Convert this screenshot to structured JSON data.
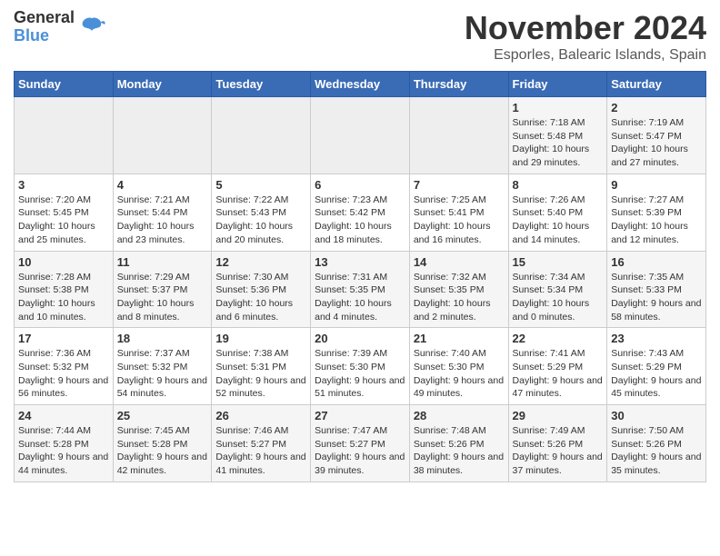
{
  "logo": {
    "line1": "General",
    "line2": "Blue"
  },
  "title": "November 2024",
  "location": "Esporles, Balearic Islands, Spain",
  "headers": [
    "Sunday",
    "Monday",
    "Tuesday",
    "Wednesday",
    "Thursday",
    "Friday",
    "Saturday"
  ],
  "weeks": [
    [
      {
        "day": "",
        "info": ""
      },
      {
        "day": "",
        "info": ""
      },
      {
        "day": "",
        "info": ""
      },
      {
        "day": "",
        "info": ""
      },
      {
        "day": "",
        "info": ""
      },
      {
        "day": "1",
        "info": "Sunrise: 7:18 AM\nSunset: 5:48 PM\nDaylight: 10 hours and 29 minutes."
      },
      {
        "day": "2",
        "info": "Sunrise: 7:19 AM\nSunset: 5:47 PM\nDaylight: 10 hours and 27 minutes."
      }
    ],
    [
      {
        "day": "3",
        "info": "Sunrise: 7:20 AM\nSunset: 5:45 PM\nDaylight: 10 hours and 25 minutes."
      },
      {
        "day": "4",
        "info": "Sunrise: 7:21 AM\nSunset: 5:44 PM\nDaylight: 10 hours and 23 minutes."
      },
      {
        "day": "5",
        "info": "Sunrise: 7:22 AM\nSunset: 5:43 PM\nDaylight: 10 hours and 20 minutes."
      },
      {
        "day": "6",
        "info": "Sunrise: 7:23 AM\nSunset: 5:42 PM\nDaylight: 10 hours and 18 minutes."
      },
      {
        "day": "7",
        "info": "Sunrise: 7:25 AM\nSunset: 5:41 PM\nDaylight: 10 hours and 16 minutes."
      },
      {
        "day": "8",
        "info": "Sunrise: 7:26 AM\nSunset: 5:40 PM\nDaylight: 10 hours and 14 minutes."
      },
      {
        "day": "9",
        "info": "Sunrise: 7:27 AM\nSunset: 5:39 PM\nDaylight: 10 hours and 12 minutes."
      }
    ],
    [
      {
        "day": "10",
        "info": "Sunrise: 7:28 AM\nSunset: 5:38 PM\nDaylight: 10 hours and 10 minutes."
      },
      {
        "day": "11",
        "info": "Sunrise: 7:29 AM\nSunset: 5:37 PM\nDaylight: 10 hours and 8 minutes."
      },
      {
        "day": "12",
        "info": "Sunrise: 7:30 AM\nSunset: 5:36 PM\nDaylight: 10 hours and 6 minutes."
      },
      {
        "day": "13",
        "info": "Sunrise: 7:31 AM\nSunset: 5:35 PM\nDaylight: 10 hours and 4 minutes."
      },
      {
        "day": "14",
        "info": "Sunrise: 7:32 AM\nSunset: 5:35 PM\nDaylight: 10 hours and 2 minutes."
      },
      {
        "day": "15",
        "info": "Sunrise: 7:34 AM\nSunset: 5:34 PM\nDaylight: 10 hours and 0 minutes."
      },
      {
        "day": "16",
        "info": "Sunrise: 7:35 AM\nSunset: 5:33 PM\nDaylight: 9 hours and 58 minutes."
      }
    ],
    [
      {
        "day": "17",
        "info": "Sunrise: 7:36 AM\nSunset: 5:32 PM\nDaylight: 9 hours and 56 minutes."
      },
      {
        "day": "18",
        "info": "Sunrise: 7:37 AM\nSunset: 5:32 PM\nDaylight: 9 hours and 54 minutes."
      },
      {
        "day": "19",
        "info": "Sunrise: 7:38 AM\nSunset: 5:31 PM\nDaylight: 9 hours and 52 minutes."
      },
      {
        "day": "20",
        "info": "Sunrise: 7:39 AM\nSunset: 5:30 PM\nDaylight: 9 hours and 51 minutes."
      },
      {
        "day": "21",
        "info": "Sunrise: 7:40 AM\nSunset: 5:30 PM\nDaylight: 9 hours and 49 minutes."
      },
      {
        "day": "22",
        "info": "Sunrise: 7:41 AM\nSunset: 5:29 PM\nDaylight: 9 hours and 47 minutes."
      },
      {
        "day": "23",
        "info": "Sunrise: 7:43 AM\nSunset: 5:29 PM\nDaylight: 9 hours and 45 minutes."
      }
    ],
    [
      {
        "day": "24",
        "info": "Sunrise: 7:44 AM\nSunset: 5:28 PM\nDaylight: 9 hours and 44 minutes."
      },
      {
        "day": "25",
        "info": "Sunrise: 7:45 AM\nSunset: 5:28 PM\nDaylight: 9 hours and 42 minutes."
      },
      {
        "day": "26",
        "info": "Sunrise: 7:46 AM\nSunset: 5:27 PM\nDaylight: 9 hours and 41 minutes."
      },
      {
        "day": "27",
        "info": "Sunrise: 7:47 AM\nSunset: 5:27 PM\nDaylight: 9 hours and 39 minutes."
      },
      {
        "day": "28",
        "info": "Sunrise: 7:48 AM\nSunset: 5:26 PM\nDaylight: 9 hours and 38 minutes."
      },
      {
        "day": "29",
        "info": "Sunrise: 7:49 AM\nSunset: 5:26 PM\nDaylight: 9 hours and 37 minutes."
      },
      {
        "day": "30",
        "info": "Sunrise: 7:50 AM\nSunset: 5:26 PM\nDaylight: 9 hours and 35 minutes."
      }
    ]
  ]
}
